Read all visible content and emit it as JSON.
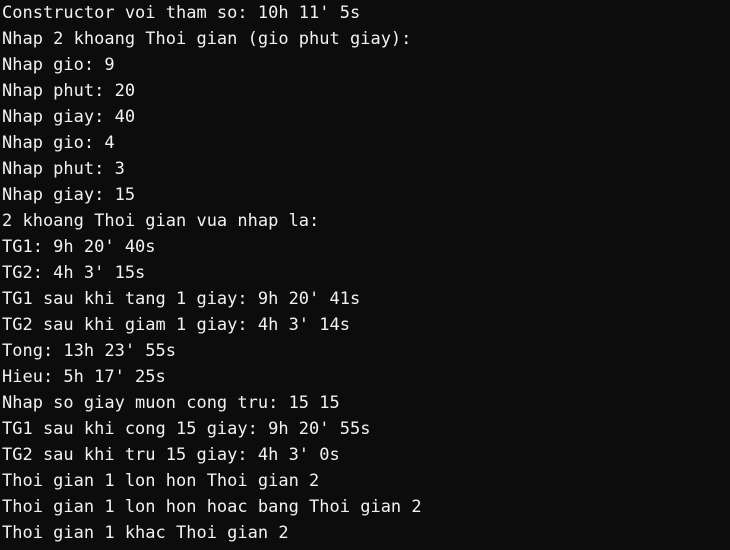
{
  "terminal": {
    "lines": [
      "Constructor voi tham so: 10h 11' 5s",
      "Nhap 2 khoang Thoi gian (gio phut giay):",
      "Nhap gio: 9",
      "Nhap phut: 20",
      "Nhap giay: 40",
      "Nhap gio: 4",
      "Nhap phut: 3",
      "Nhap giay: 15",
      "2 khoang Thoi gian vua nhap la:",
      "TG1: 9h 20' 40s",
      "TG2: 4h 3' 15s",
      "TG1 sau khi tang 1 giay: 9h 20' 41s",
      "TG2 sau khi giam 1 giay: 4h 3' 14s",
      "Tong: 13h 23' 55s",
      "Hieu: 5h 17' 25s",
      "Nhap so giay muon cong tru: 15 15",
      "TG1 sau khi cong 15 giay: 9h 20' 55s",
      "TG2 sau khi tru 15 giay: 4h 3' 0s",
      "Thoi gian 1 lon hon Thoi gian 2",
      "Thoi gian 1 lon hon hoac bang Thoi gian 2",
      "Thoi gian 1 khac Thoi gian 2"
    ]
  },
  "colors": {
    "background": "#0c0c0c",
    "text": "#f2f2f2"
  }
}
